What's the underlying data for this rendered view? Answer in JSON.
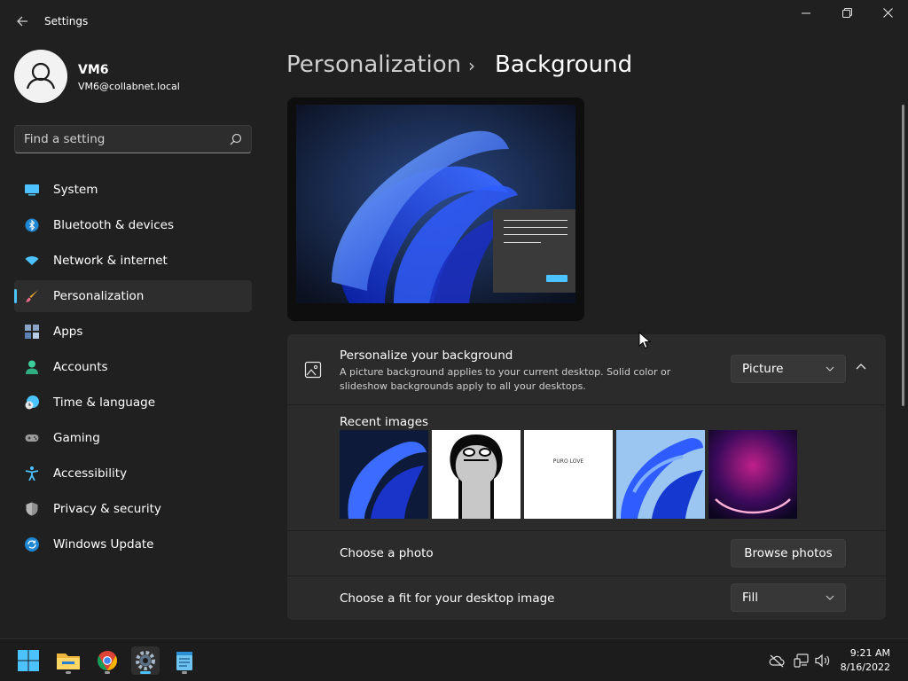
{
  "window": {
    "title": "Settings",
    "back_icon": "arrow-left-icon",
    "minimize_icon": "minimize-icon",
    "maximize_icon": "restore-icon",
    "close_icon": "close-icon"
  },
  "profile": {
    "name": "VM6",
    "email": "VM6@collabnet.local"
  },
  "search": {
    "placeholder": "Find a setting",
    "value": ""
  },
  "nav": {
    "items": [
      {
        "label": "System",
        "icon": "monitor-icon",
        "active": false
      },
      {
        "label": "Bluetooth & devices",
        "icon": "bluetooth-icon",
        "active": false
      },
      {
        "label": "Network & internet",
        "icon": "wifi-icon",
        "active": false
      },
      {
        "label": "Personalization",
        "icon": "brush-icon",
        "active": true
      },
      {
        "label": "Apps",
        "icon": "apps-icon",
        "active": false
      },
      {
        "label": "Accounts",
        "icon": "person-icon",
        "active": false
      },
      {
        "label": "Time & language",
        "icon": "clock-globe-icon",
        "active": false
      },
      {
        "label": "Gaming",
        "icon": "gamepad-icon",
        "active": false
      },
      {
        "label": "Accessibility",
        "icon": "accessibility-icon",
        "active": false
      },
      {
        "label": "Privacy & security",
        "icon": "shield-icon",
        "active": false
      },
      {
        "label": "Windows Update",
        "icon": "update-icon",
        "active": false
      }
    ]
  },
  "breadcrumb": {
    "parent": "Personalization",
    "separator": "›",
    "current": "Background"
  },
  "background_card": {
    "title": "Personalize your background",
    "description": "A picture background applies to your current desktop. Solid color or slideshow backgrounds apply to all your desktops.",
    "dropdown_value": "Picture",
    "recent_label": "Recent images",
    "thumbnail_text": "PURO LOVE",
    "choose_photo_label": "Choose a photo",
    "browse_button": "Browse photos",
    "fit_label": "Choose a fit for your desktop image",
    "fit_value": "Fill"
  },
  "taskbar": {
    "apps": [
      "start-icon",
      "file-explorer-icon",
      "chrome-icon",
      "settings-icon",
      "notepad-icon"
    ],
    "time": "9:21 AM",
    "date": "8/16/2022"
  },
  "colors": {
    "accent": "#4cc2ff",
    "background": "#202020",
    "card": "#2b2b2b"
  }
}
